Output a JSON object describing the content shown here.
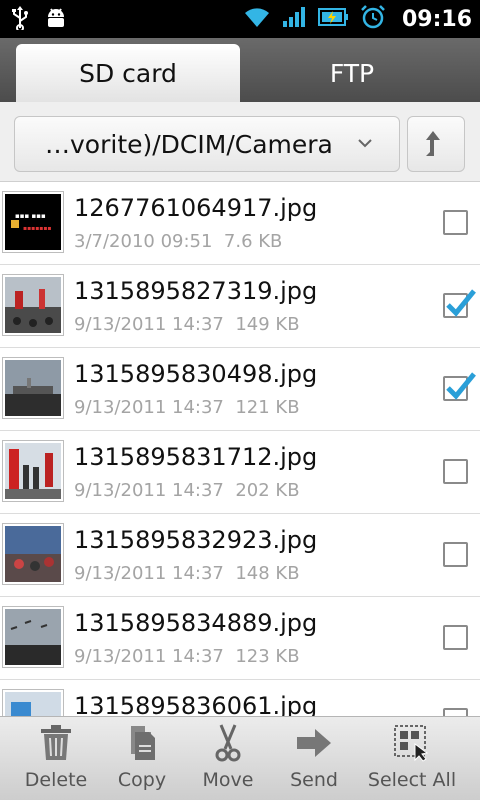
{
  "status_bar": {
    "time": "09:16"
  },
  "tabs": [
    {
      "label": "SD card",
      "active": true
    },
    {
      "label": "FTP",
      "active": false
    }
  ],
  "path": {
    "text": "…vorite)/DCIM/Camera"
  },
  "files": [
    {
      "name": "1267761064917.jpg",
      "date": "3/7/2010 09:51",
      "size": "7.6 KB",
      "checked": false
    },
    {
      "name": "1315895827319.jpg",
      "date": "9/13/2011 14:37",
      "size": "149 KB",
      "checked": true
    },
    {
      "name": "1315895830498.jpg",
      "date": "9/13/2011 14:37",
      "size": "121 KB",
      "checked": true
    },
    {
      "name": "1315895831712.jpg",
      "date": "9/13/2011 14:37",
      "size": "202 KB",
      "checked": false
    },
    {
      "name": "1315895832923.jpg",
      "date": "9/13/2011 14:37",
      "size": "148 KB",
      "checked": false
    },
    {
      "name": "1315895834889.jpg",
      "date": "9/13/2011 14:37",
      "size": "123 KB",
      "checked": false
    },
    {
      "name": "1315895836061.jpg",
      "date": "",
      "size": "",
      "checked": false
    }
  ],
  "toolbar": {
    "delete": "Delete",
    "copy": "Copy",
    "move": "Move",
    "send": "Send",
    "select_all": "Select All"
  },
  "colors": {
    "accent": "#2a9fd8",
    "status_icon": "#33b5e5"
  }
}
